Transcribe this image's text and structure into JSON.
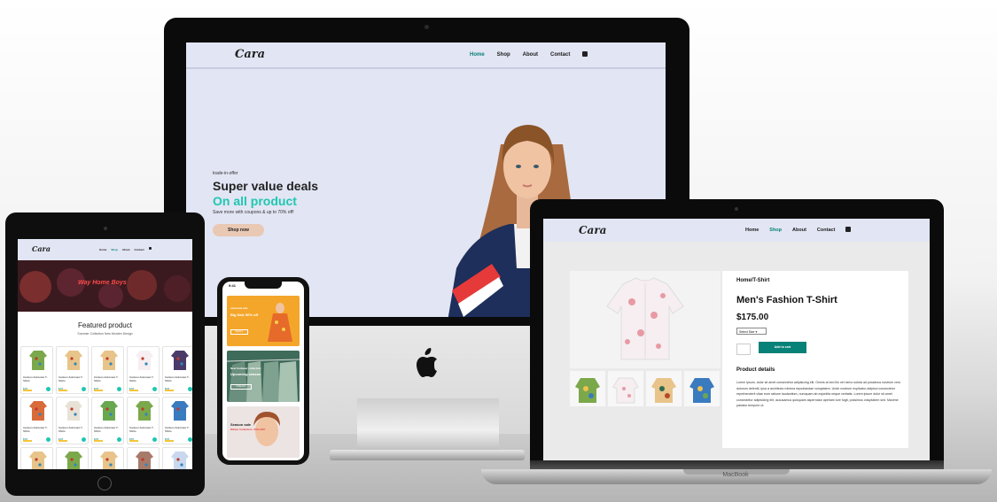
{
  "brand": {
    "logo": "Cara",
    "accent": "#088178",
    "hero_accent": "#1ec7b2"
  },
  "nav": {
    "items": [
      "Home",
      "Shop",
      "About",
      "Contact"
    ],
    "imac_active": 0,
    "macbook_active": 1
  },
  "imac": {
    "hero_small": "trade-in-offer",
    "hero_h2": "Super value deals",
    "hero_h1": "On all product",
    "hero_p": "Save more with coupons & up to 70% off!",
    "hero_button": "Shop now"
  },
  "tablet": {
    "nav_items": [
      "Home",
      "Shop",
      "About",
      "Contact"
    ],
    "banner_text": "Way Home Boys",
    "featured_title": "Featured product",
    "featured_sub": "Summer Collection New Morden Design",
    "product_brand": "adidas",
    "product_name": "Cartoon Astronaut T-Shirts",
    "product_price": "$78"
  },
  "phone": {
    "time": "9:41",
    "promo1_title": "Big Sale 50% off",
    "promo1_sub": "seasonal sale",
    "promo1_button": "Explore",
    "promo2_title": "Upcoming season",
    "promo2_sub": "New footwear collection",
    "promo2_button": "Collection",
    "promo3_title": "Season sale",
    "promo3_sub": "Winter Collection -50% OFF"
  },
  "macbook": {
    "breadcrumb": "Home/T-Shirt",
    "title": "Men's Fashion T-Shirt",
    "price": "$175.00",
    "select_label": "Select Size",
    "add_button": "Add to cart",
    "details_heading": "Product details",
    "details_text": "Lorem ipsum, dolor sit amet consectetur adipisicing elit. Omnis at sed illo vel nemo soluta ad possimus nostrum vero dolorum deleniti, ipsa a architecto minima repudiandae voluptatem. Unde nostrum explicabo adipisci consectetur reprehenderit vitae eum ratione laudantium, numquam ab expedita neque veritatis. Lorem ipsum dolor sit amet consectetur adipisicing elit, accusamus quisquam aspernatur aperiam iure fugit, possimus voluptatem sint. Maxime pariatur tempore ut.",
    "label": "MacBook"
  }
}
